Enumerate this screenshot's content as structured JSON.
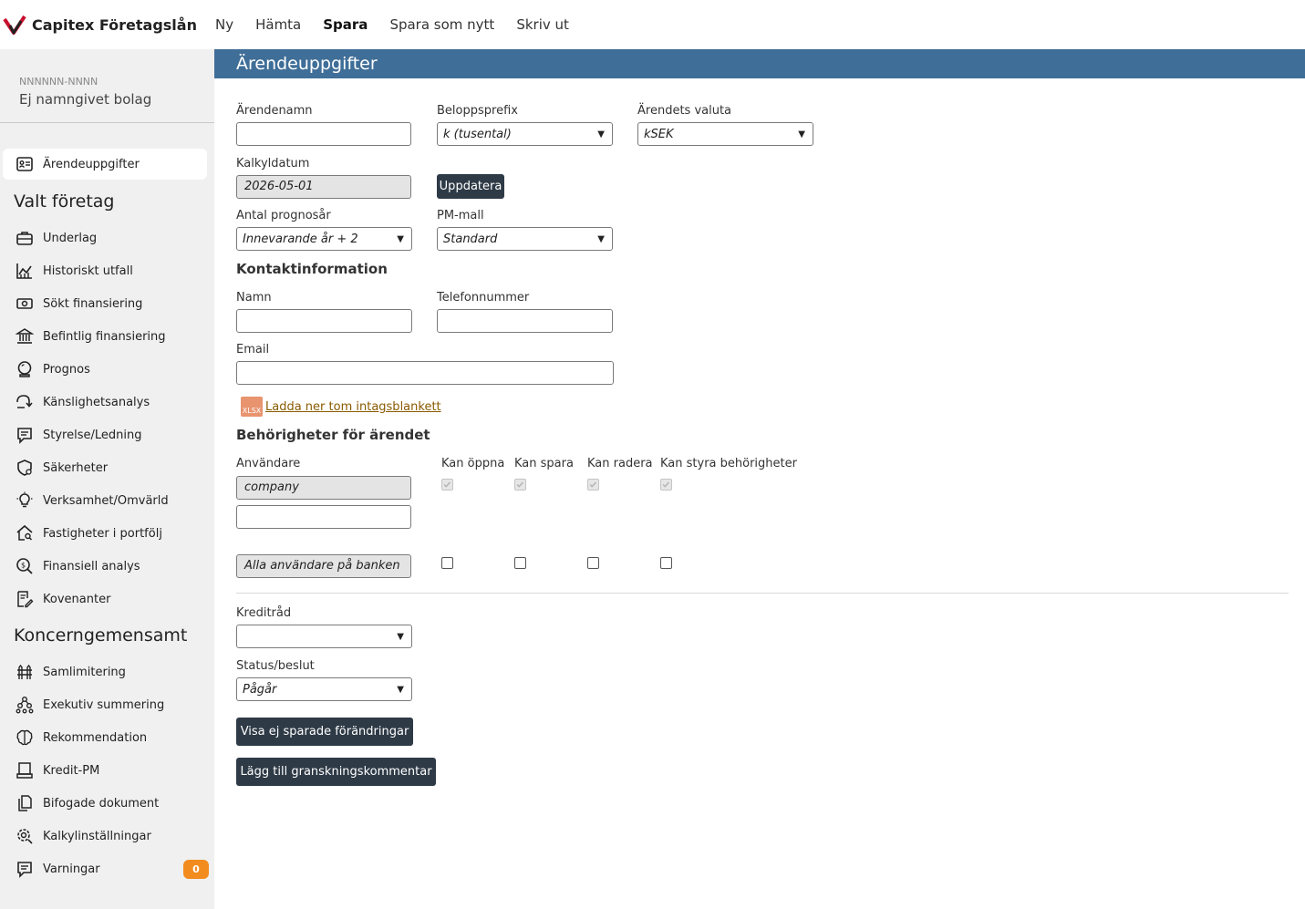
{
  "app": {
    "title": "Capitex Företagslån",
    "menu": [
      "Ny",
      "Hämta",
      "Spara",
      "Spara som nytt",
      "Skriv ut"
    ],
    "active_menu": "Spara"
  },
  "company": {
    "id": "NNNNNN-NNNN",
    "name": "Ej namngivet bolag"
  },
  "sidebar": {
    "top_item": "Ärendeuppgifter",
    "section1": "Valt företag",
    "items1": [
      "Underlag",
      "Historiskt utfall",
      "Sökt finansiering",
      "Befintlig finansiering",
      "Prognos",
      "Känslighetsanalys",
      "Styrelse/Ledning",
      "Säkerheter",
      "Verksamhet/Omvärld",
      "Fastigheter i portfölj",
      "Finansiell analys",
      "Kovenanter"
    ],
    "section2": "Koncerngemensamt",
    "items2": [
      "Samlimitering",
      "Exekutiv summering",
      "Rekommendation",
      "Kredit-PM",
      "Bifogade dokument",
      "Kalkylinställningar",
      "Varningar"
    ],
    "warnings_count": "0"
  },
  "header": {
    "title": "Ärendeuppgifter"
  },
  "form": {
    "case_name_label": "Ärendenamn",
    "case_name_value": "",
    "amount_prefix_label": "Beloppsprefix",
    "amount_prefix_value": "k (tusental)",
    "currency_label": "Ärendets valuta",
    "currency_value": "kSEK",
    "calc_date_label": "Kalkyldatum",
    "calc_date_value": "2026-05-01",
    "update_button": "Uppdatera",
    "forecast_years_label": "Antal prognosår",
    "forecast_years_value": "Innevarande år + 2",
    "pm_template_label": "PM-mall",
    "pm_template_value": "Standard"
  },
  "contact": {
    "title": "Kontaktinformation",
    "name_label": "Namn",
    "phone_label": "Telefonnummer",
    "email_label": "Email",
    "download_link": "Ladda ner tom intagsblankett",
    "xlsx_label": "XLSX"
  },
  "permissions": {
    "title": "Behörigheter för ärendet",
    "user_label": "Användare",
    "col_open": "Kan öppna",
    "col_save": "Kan spara",
    "col_delete": "Kan radera",
    "col_manage": "Kan styra behörigheter",
    "user1": "company",
    "user2": "",
    "all_users": "Alla användare på banken"
  },
  "review": {
    "credit_council_label": "Kreditråd",
    "credit_council_value": "",
    "status_label": "Status/beslut",
    "status_value": "Pågår",
    "show_unsaved_button": "Visa ej sparade förändringar",
    "add_comment_button": "Lägg till granskningskommentar"
  },
  "colors": {
    "header_bg": "#3f6e98",
    "button_dark": "#2e3a46",
    "badge": "#f28c1e",
    "sidebar_bg": "#f0f0f0",
    "link": "#8a5a00"
  }
}
